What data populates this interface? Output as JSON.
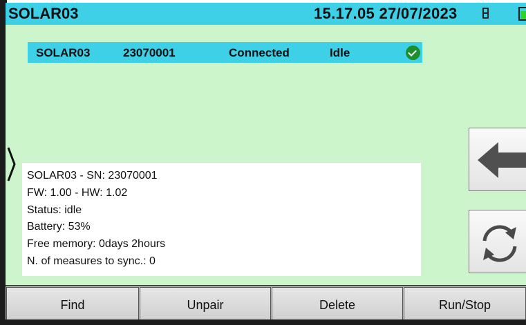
{
  "header": {
    "title": "SOLAR03",
    "datetime": "15.17.05 27/07/2023",
    "memory_icon": "memory-icon",
    "battery_icon": "battery-icon"
  },
  "device_list": [
    {
      "name": "SOLAR03",
      "serial": "23070001",
      "connection": "Connected",
      "state": "Idle",
      "status_icon": "check-icon",
      "selected": true
    }
  ],
  "info": {
    "lines": [
      "SOLAR03 - SN: 23070001",
      "FW: 1.00 - HW: 1.02",
      "Status: idle",
      "Battery: 53%",
      "Free memory: 0days 2hours",
      "N. of measures to sync.: 0"
    ]
  },
  "side_buttons": {
    "back_icon": "arrow-left-icon",
    "refresh_icon": "refresh-icon"
  },
  "bottom_buttons": [
    "Find",
    "Unpair",
    "Delete",
    "Run/Stop"
  ],
  "colors": {
    "background": "#ccf5cc",
    "accent": "#3dd0e6",
    "check": "#1e8f2d",
    "battery_fill": "#2fd12f"
  }
}
